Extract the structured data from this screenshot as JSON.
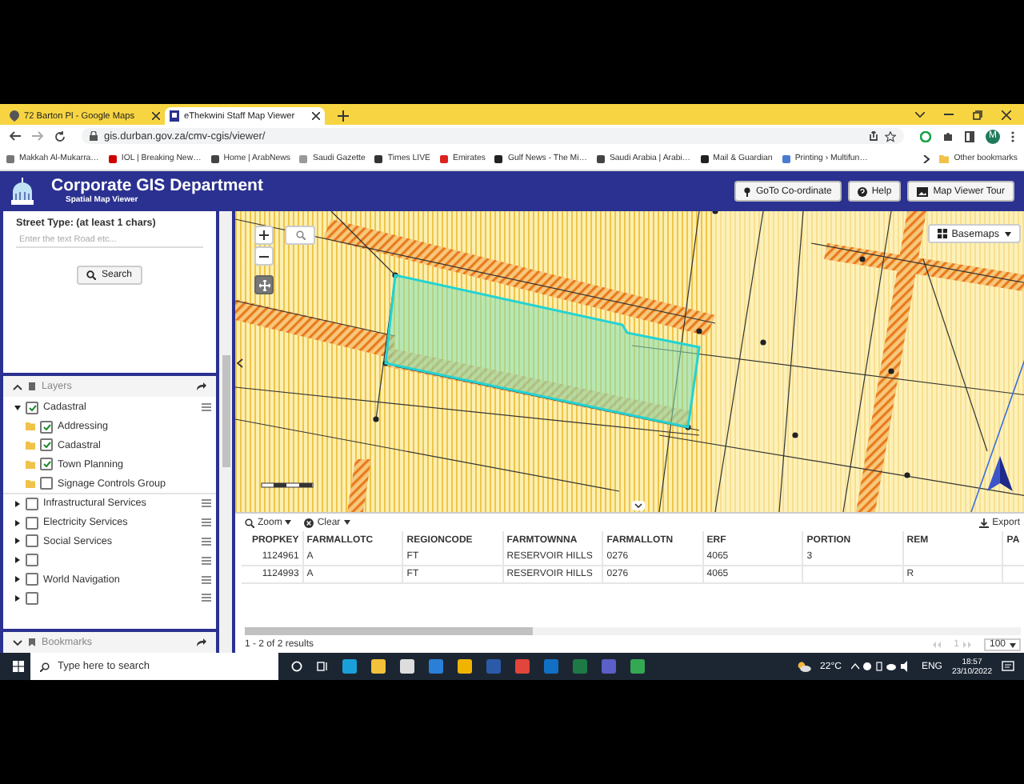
{
  "browser": {
    "tabs": [
      {
        "title": "72 Barton Pl - Google Maps",
        "selected": false
      },
      {
        "title": "eThekwini Staff Map Viewer",
        "selected": true
      }
    ],
    "url": "gis.durban.gov.za/cmv-cgis/viewer/",
    "profile_initial": "M",
    "bookmarks": [
      "Makkah Al-Mukarra…",
      "IOL | Breaking New…",
      "Home | ArabNews",
      "Saudi Gazette",
      "Times LIVE",
      "Emirates",
      "Gulf News - The Mi…",
      "Saudi Arabia | Arabi…",
      "Mail & Guardian",
      "Printing › Multifun…"
    ],
    "other_bookmarks": "Other bookmarks"
  },
  "app": {
    "title": "Corporate GIS Department",
    "subtitle": "Spatial Map Viewer",
    "buttons": [
      "GoTo Co-ordinate",
      "Help",
      "Map Viewer Tour"
    ]
  },
  "search_panel": {
    "label": "Street Type: (at least 1 chars)",
    "placeholder": "Enter the text Road etc...",
    "button": "Search"
  },
  "layers": {
    "title": "Layers",
    "items": [
      {
        "label": "Cadastral",
        "checked": true,
        "expanded": true,
        "children": [
          {
            "label": "Addressing",
            "checked": true
          },
          {
            "label": "Cadastral",
            "checked": true
          },
          {
            "label": "Town Planning",
            "checked": true
          },
          {
            "label": "Signage Controls Group",
            "checked": false
          }
        ]
      },
      {
        "label": "Infrastructural Services",
        "checked": false,
        "expanded": false
      },
      {
        "label": "Electricity Services",
        "checked": false,
        "expanded": false
      },
      {
        "label": "Social Services",
        "checked": false,
        "expanded": false
      },
      {
        "checked": false,
        "expanded": false
      },
      {
        "label": "World Navigation",
        "checked": false,
        "expanded": false
      },
      {
        "checked": false,
        "expanded": false
      }
    ]
  },
  "bookmarks_panel": {
    "title": "Bookmarks"
  },
  "map": {
    "basemaps_button": "Basemaps"
  },
  "results": {
    "tools": [
      "Zoom",
      "Clear"
    ],
    "export": "Export",
    "columns": [
      "PROPKEY",
      "FARMALLOTC",
      "REGIONCODE",
      "FARMTOWNNA",
      "FARMALLOTN",
      "ERF",
      "PORTION",
      "REM",
      "PA"
    ],
    "rows": [
      [
        "1124961",
        "A",
        "FT",
        "RESERVOIR HILLS",
        "0276",
        "4065",
        "3",
        null,
        null
      ],
      [
        "1124993",
        "A",
        "FT",
        "RESERVOIR HILLS",
        "0276",
        "4065",
        null,
        "R",
        null
      ]
    ],
    "summary": "1 - 2 of 2 results",
    "page": "1",
    "page_size": "100"
  },
  "taskbar": {
    "search_placeholder": "Type here to search",
    "temperature": "22°C",
    "language": "ENG",
    "time": "18:57",
    "date": "23/10/2022"
  }
}
